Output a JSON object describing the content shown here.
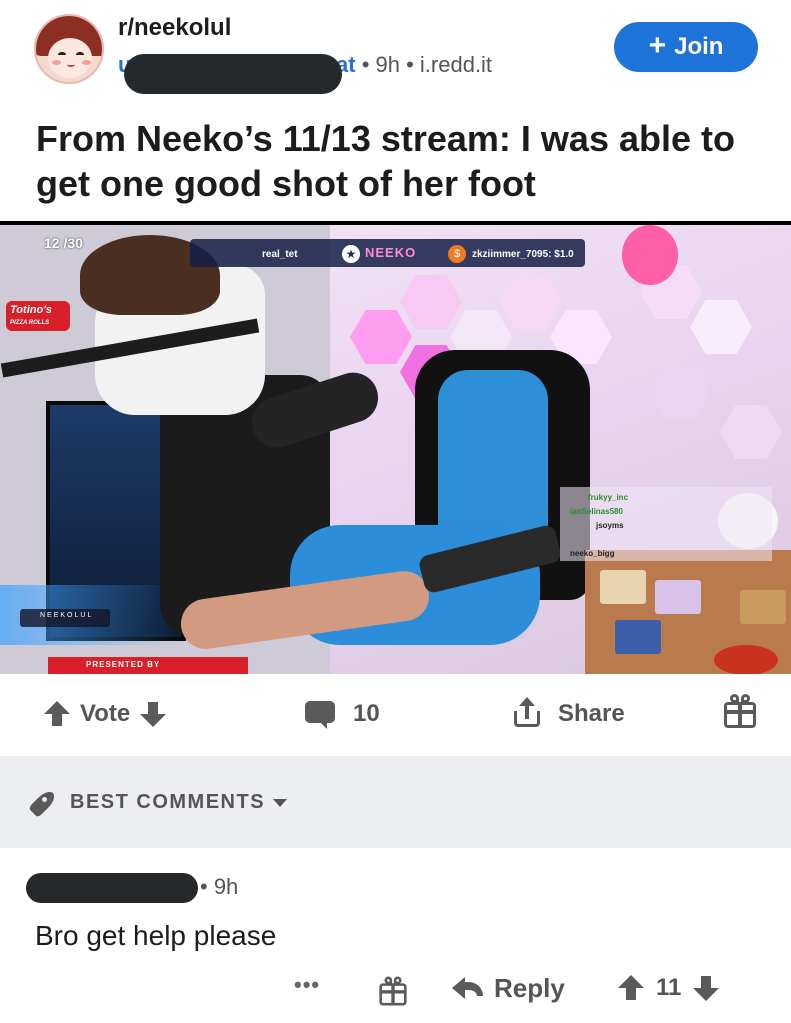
{
  "post": {
    "subreddit": "r/neekolul",
    "author_visible_fragment": "u",
    "author_visible_suffix": "at",
    "meta": "• 9h • i.redd.it",
    "join_label": "Join",
    "title": "From Neeko’s 11/13 stream: I was able to get one good shot of her foot"
  },
  "media": {
    "overlay": {
      "counter": "12 /30",
      "user_left": "real_tet",
      "channel_logo": "NEEKO",
      "tip_text": "zkziimmer_7095: $1.0",
      "brand": "Totino's",
      "brand_sub": "PIZZA ROLLS",
      "channel_tag": "NEEKOLUL",
      "presented_by": "PRESENTED BY",
      "chat": [
        {
          "user": "frukyy_inc",
          "text": ""
        },
        {
          "user": "lanSelinas580",
          "text": ""
        },
        {
          "user": "jsoyms",
          "text": ""
        },
        {
          "user": "neeko_bigg",
          "text": ""
        }
      ]
    }
  },
  "actions": {
    "vote_label": "Vote",
    "comment_count": "10",
    "share_label": "Share"
  },
  "sort": {
    "label": "BEST COMMENTS"
  },
  "comment": {
    "meta": "• 9h",
    "body": "Bro get help please",
    "more_label": "•••",
    "reply_label": "Reply",
    "score": "11"
  },
  "colors": {
    "accent": "#1d73d8",
    "text": "#1c1c1c",
    "muted": "#555555",
    "sort_bar_bg": "#eceef1",
    "redaction": "#26292c"
  },
  "icons": [
    "plus-icon",
    "upvote-icon",
    "downvote-icon",
    "comment-icon",
    "share-icon",
    "gift-icon",
    "rocket-icon",
    "chevron-down-icon",
    "reply-icon",
    "more-icon"
  ]
}
